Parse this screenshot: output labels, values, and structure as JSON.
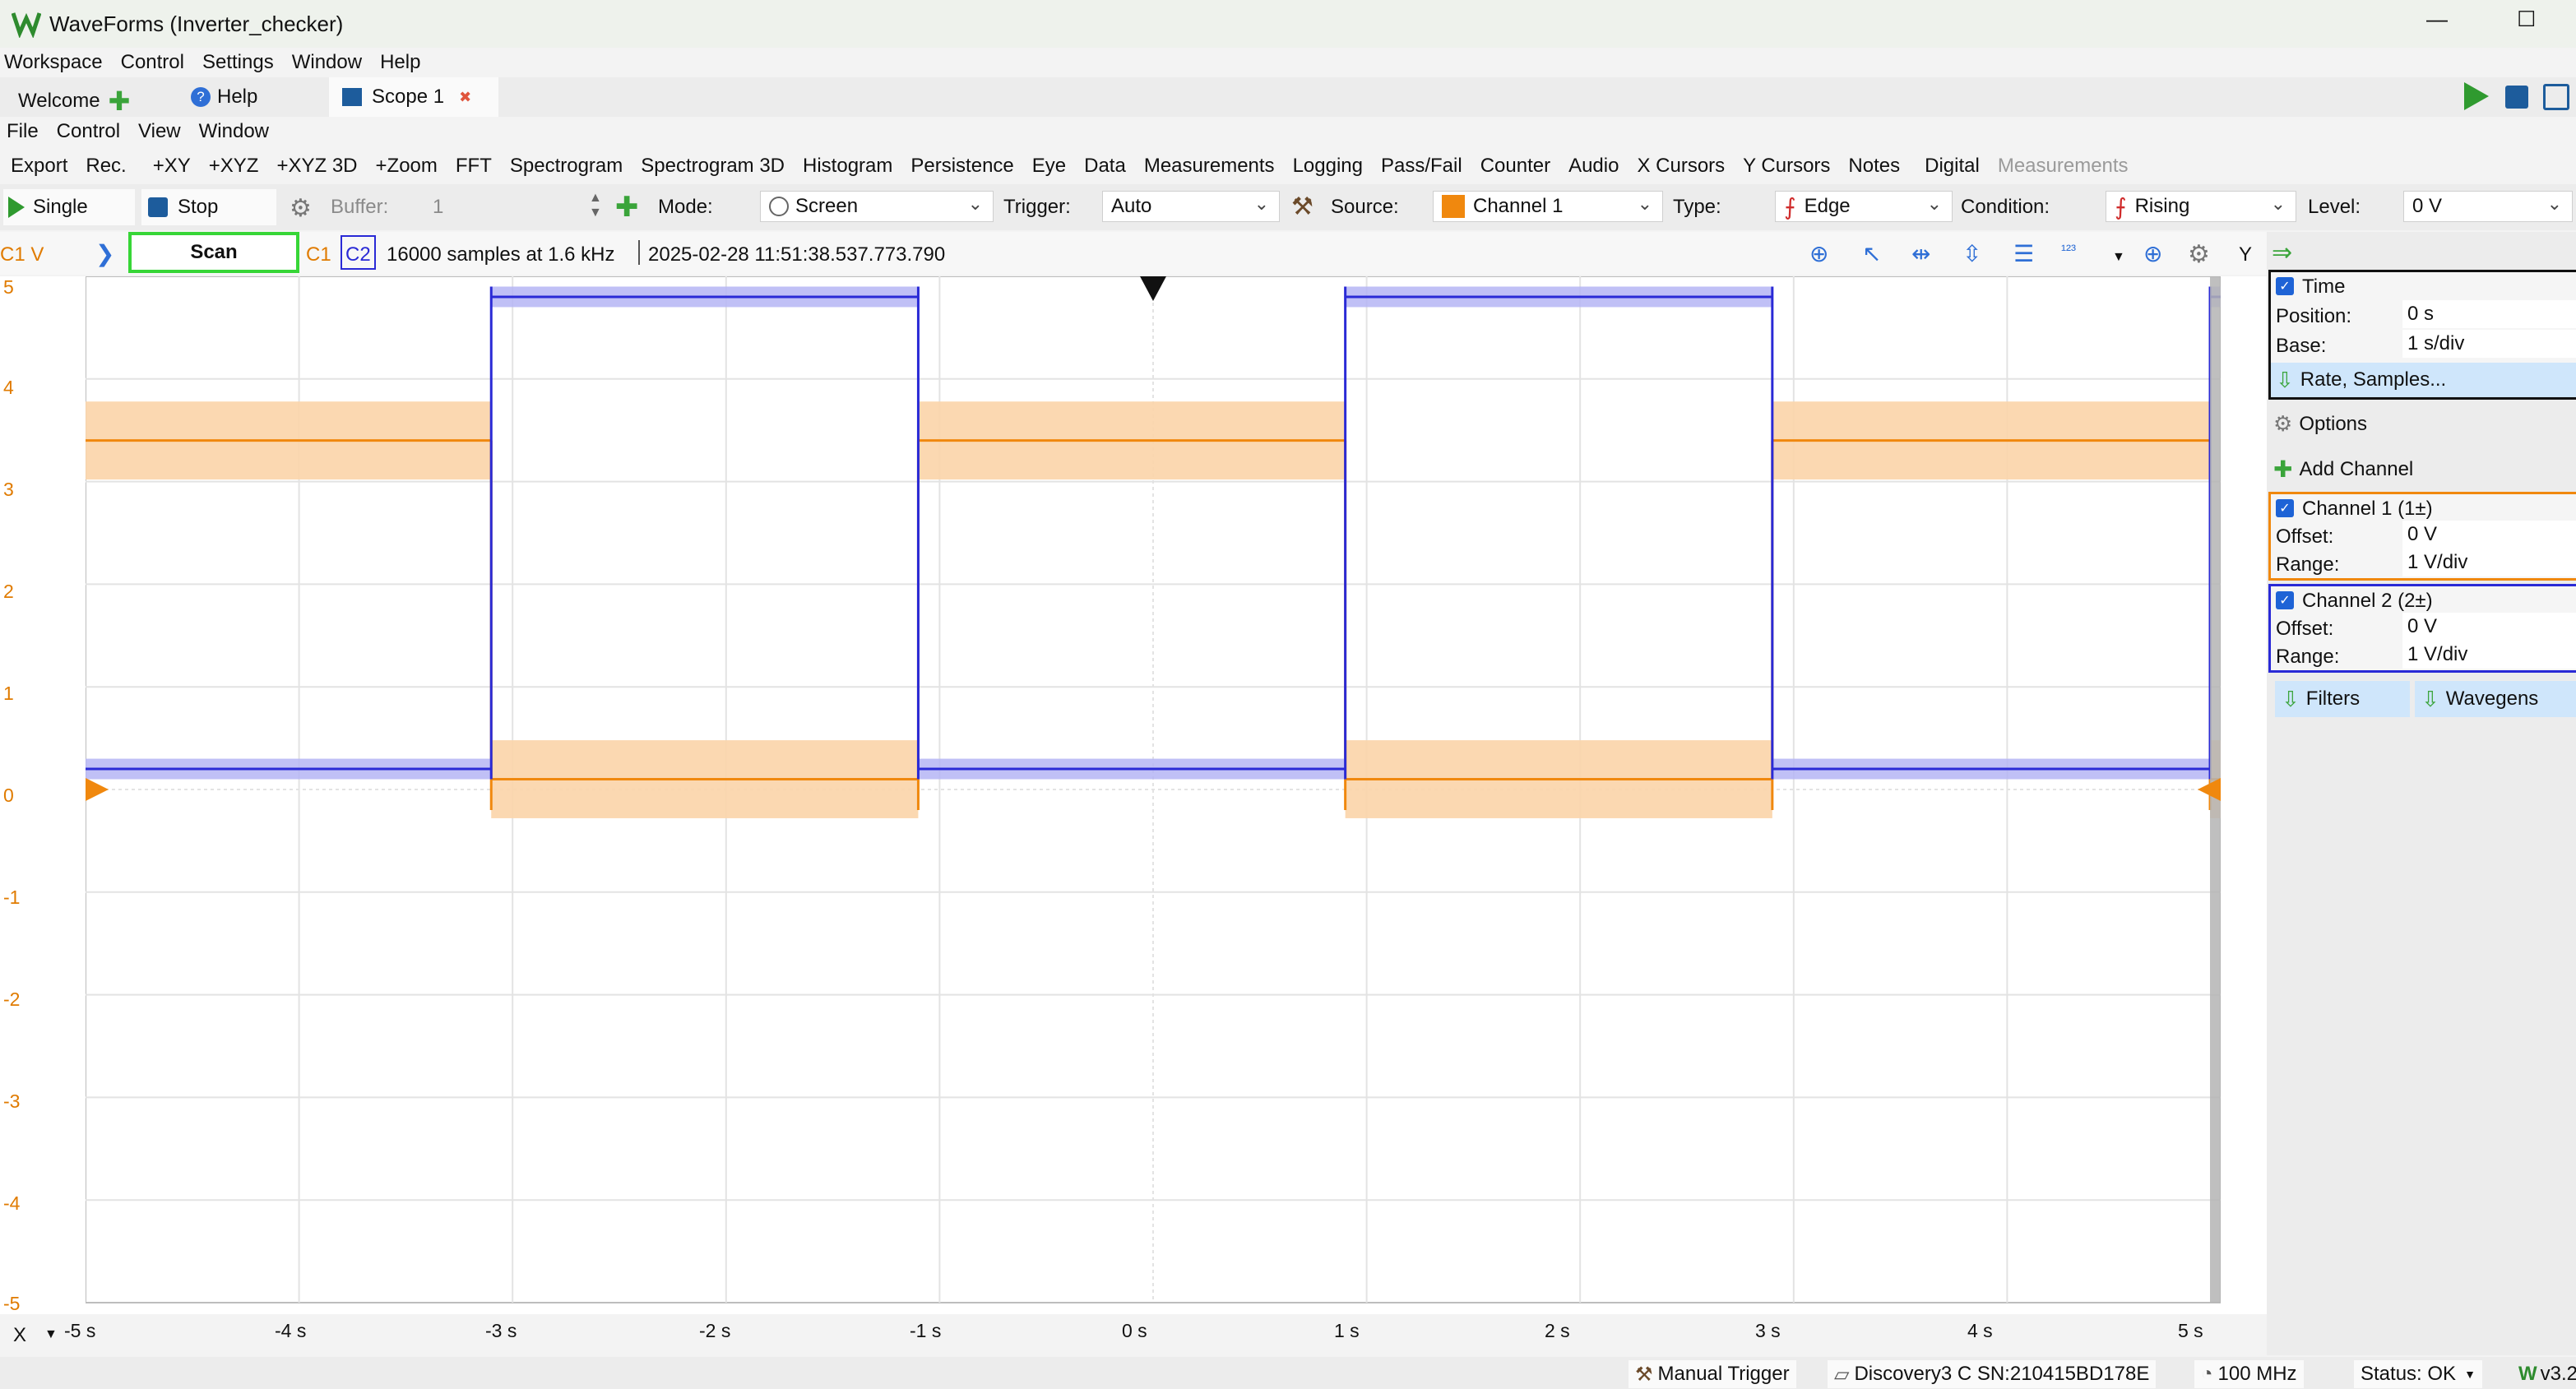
{
  "window": {
    "title": "WaveForms (Inverter_checker)",
    "minimize": "—",
    "maximize": "☐"
  },
  "main_menu": [
    "Workspace",
    "Control",
    "Settings",
    "Window",
    "Help"
  ],
  "tabs": {
    "welcome": "Welcome",
    "help": "Help",
    "scope": "Scope 1"
  },
  "scope_menu": [
    "File",
    "Control",
    "View",
    "Window"
  ],
  "toolbar": {
    "items": [
      "Export",
      "Rec.",
      "+XY",
      "+XYZ",
      "+XYZ 3D",
      "+Zoom",
      "FFT",
      "Spectrogram",
      "Spectrogram 3D",
      "Histogram",
      "Persistence",
      "Eye",
      "Data",
      "Measurements",
      "Logging",
      "Pass/Fail",
      "Counter",
      "Audio",
      "X Cursors",
      "Y Cursors",
      "Notes"
    ],
    "digital": "Digital",
    "measurements_disabled": "Measurements"
  },
  "acq": {
    "single": "Single",
    "stop": "Stop",
    "buffer_label": "Buffer:",
    "buffer_value": "1",
    "mode_label": "Mode:",
    "mode_value": "Screen",
    "trigger_label": "Trigger:",
    "trigger_value": "Auto",
    "source_label": "Source:",
    "source_value": "Channel 1",
    "type_label": "Type:",
    "type_value": "Edge",
    "condition_label": "Condition:",
    "condition_value": "Rising",
    "level_label": "Level:",
    "level_value": "0 V"
  },
  "status_line": {
    "channel_unit": "C1 V",
    "scan": "Scan",
    "c1": "C1",
    "c2": "C2",
    "info": "16000 samples at 1.6 kHz",
    "timestamp": "2025-02-28 11:51:38.537.773.790",
    "y_button": "Y",
    "x_button": "X"
  },
  "plot": {
    "y_ticks": [
      "5",
      "4",
      "3",
      "2",
      "1",
      "0",
      "-1",
      "-2",
      "-3",
      "-4",
      "-5"
    ],
    "x_ticks": [
      "-5 s",
      "-4 s",
      "-3 s",
      "-2 s",
      "-1 s",
      "0 s",
      "1 s",
      "2 s",
      "3 s",
      "4 s",
      "5 s"
    ],
    "channel1_color": "#f0880e",
    "channel2_color": "#2a2ad6",
    "channel1_band_color": "#fbd4a8",
    "channel2_band_color": "#b5b5f5",
    "c2_edges_s": [
      -3.1,
      -1.1,
      0.9,
      2.9,
      4.95
    ],
    "c2_high_v": 4.8,
    "c2_low_v": 0.2,
    "c1_high_v": 3.4,
    "c1_low_v": 0.1
  },
  "right_panel": {
    "time_title": "Time",
    "position_label": "Position:",
    "position_value": "0 s",
    "base_label": "Base:",
    "base_value": "1 s/div",
    "rate_button": "Rate, Samples...",
    "options": "Options",
    "add_channel": "Add Channel",
    "ch1_title": "Channel 1 (1±)",
    "ch1_offset_label": "Offset:",
    "ch1_offset": "0 V",
    "ch1_range_label": "Range:",
    "ch1_range": "1 V/div",
    "ch2_title": "Channel 2 (2±)",
    "ch2_offset_label": "Offset:",
    "ch2_offset": "0 V",
    "ch2_range_label": "Range:",
    "ch2_range": "1 V/div",
    "filters": "Filters",
    "wavegens": "Wavegens"
  },
  "statusbar": {
    "manual_trigger": "Manual Trigger",
    "device": "Discovery3 C SN:210415BD178E",
    "clock": "100 MHz",
    "status": "Status: OK",
    "version": "v3.2"
  }
}
